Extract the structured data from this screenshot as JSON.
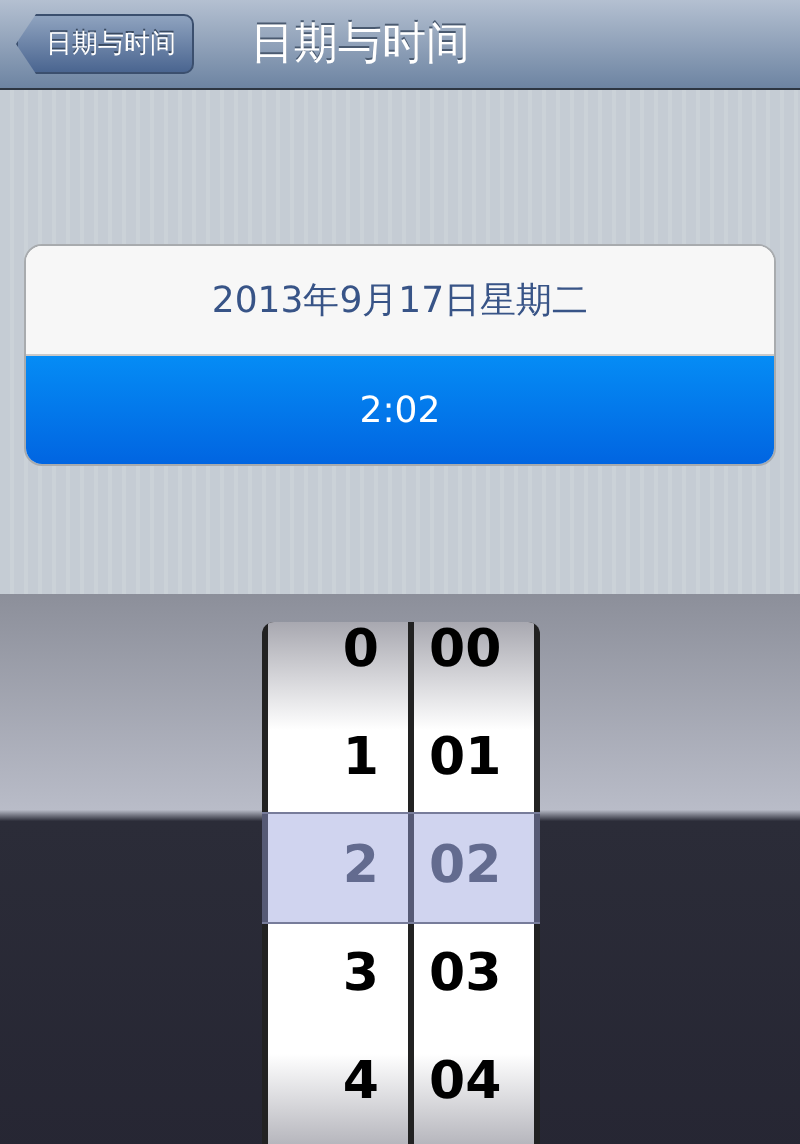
{
  "nav_bar": {
    "back_button": "日期与时间",
    "title": "日期与时间"
  },
  "rows": [
    {
      "text": "2013年9月17日星期二",
      "selected": false
    },
    {
      "text": "2:02",
      "selected": true
    }
  ],
  "picker": {
    "columns": [
      {
        "kind": "hour",
        "items": [
          {
            "text": "0",
            "selected": false
          },
          {
            "text": "1",
            "selected": false
          },
          {
            "text": "2",
            "selected": true
          },
          {
            "text": "3",
            "selected": false
          },
          {
            "text": "4",
            "selected": false
          }
        ]
      },
      {
        "kind": "minute",
        "items": [
          {
            "text": "00",
            "selected": false
          },
          {
            "text": "01",
            "selected": false
          },
          {
            "text": "02",
            "selected": true
          },
          {
            "text": "03",
            "selected": false
          },
          {
            "text": "04",
            "selected": false
          }
        ]
      }
    ]
  }
}
